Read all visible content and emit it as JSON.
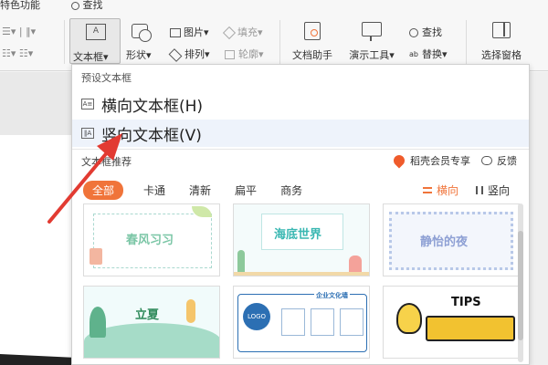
{
  "ribbon": {
    "top_left_label": "特色功能",
    "search_label": "查找",
    "textbox_label": "文本框",
    "shape_label": "形状",
    "picture_label": "图片",
    "arrange_label": "排列",
    "fill_label": "填充",
    "outline_label": "轮廓",
    "doc_assistant_label": "文档助手",
    "present_tools_label": "演示工具",
    "find_label": "查找",
    "replace_label": "替换",
    "select_pane_label": "选择窗格"
  },
  "dropdown": {
    "header": "预设文本框",
    "items": [
      {
        "icon": "horizontal-textbox-icon",
        "label": "横向文本框(H)"
      },
      {
        "icon": "vertical-textbox-icon",
        "label": "竖向文本框(V)"
      }
    ],
    "recommend_title": "文本框推荐",
    "member_label": "稻壳会员专享",
    "feedback_label": "反馈",
    "filters": [
      "全部",
      "卡通",
      "清新",
      "扁平",
      "商务"
    ],
    "active_filter": "全部",
    "orient_h": "横向",
    "orient_v": "竖向",
    "cards": [
      {
        "text": "春风习习"
      },
      {
        "text": "海底世界"
      },
      {
        "text": "静怡的夜"
      },
      {
        "text": "立夏"
      },
      {
        "text": "企业文化墙",
        "sub": "LOGO"
      },
      {
        "text": "TIPS"
      }
    ]
  },
  "colors": {
    "accent": "#f0743a",
    "arrow": "#e23b32"
  }
}
